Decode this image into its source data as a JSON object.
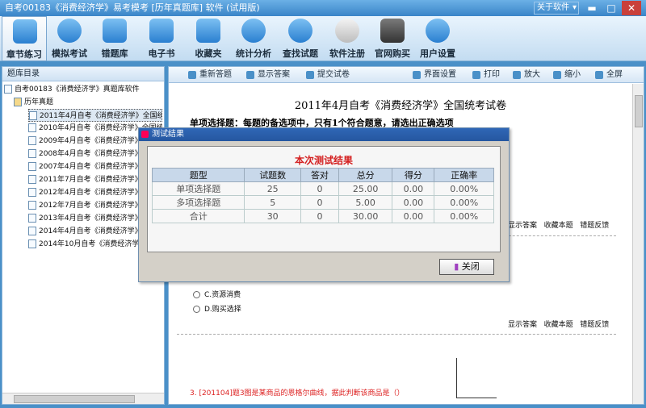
{
  "window": {
    "title": "自考00183《消费经济学》易考模考 [历年真题库] 软件 (试用版)",
    "about_label": "关于软件",
    "minimize": "▬",
    "maximize": "□",
    "close": "✕"
  },
  "toolbar": {
    "items": [
      {
        "label": "章节练习",
        "icon": "chapter-practice-icon"
      },
      {
        "label": "模拟考试",
        "icon": "mock-exam-icon"
      },
      {
        "label": "错题库",
        "icon": "wrong-question-icon"
      },
      {
        "label": "电子书",
        "icon": "ebook-icon"
      },
      {
        "label": "收藏夹",
        "icon": "favorites-icon"
      },
      {
        "label": "统计分析",
        "icon": "statistics-icon"
      },
      {
        "label": "查找试题",
        "icon": "search-icon"
      },
      {
        "label": "软件注册",
        "icon": "register-icon"
      },
      {
        "label": "官网购买",
        "icon": "cart-icon"
      },
      {
        "label": "用户设置",
        "icon": "gear-icon"
      }
    ]
  },
  "left": {
    "header": "题库目录",
    "root": "自考00183《消费经济学》真题库软件",
    "folder": "历年真题",
    "papers": [
      "2011年4月自考《消费经济学》全国统",
      "2010年4月自考《消费经济学》全国统",
      "2009年4月自考《消费经济学》全国统",
      "2008年4月自考《消费经济学》全国统",
      "2007年4月自考《消费经济学》全国统",
      "2011年7月自考《消费经济学》全国统",
      "2012年4月自考《消费经济学》全国统",
      "2012年7月自考《消费经济学》全国统",
      "2013年4月自考《消费经济学》全国统",
      "2014年4月自考《消费经济学》全国统",
      "2014年10月自考《消费经济学》全国"
    ]
  },
  "content_toolbar": {
    "redo": "重新答题",
    "show": "显示答案",
    "submit": "提交试卷",
    "layout": "界面设置",
    "print": "打印",
    "zoomin": "放大",
    "zoomout": "缩小",
    "full": "全屏"
  },
  "document": {
    "title": "2011年4月自考《消费经济学》全国统考试卷",
    "section": "单项选择题：每题的备选项中，只有1个符合题意，请选出正确选项",
    "tools": {
      "show": "显示答案",
      "fav": "收藏本题",
      "report": "错题反馈"
    },
    "optC": "C.资源消费",
    "optD": "D.购买选择",
    "q3": "3. [201104]题3图是某商品的恩格尔曲线，据此判断该商品是（）"
  },
  "dialog": {
    "title": "测试结果",
    "heading": "本次测试结果",
    "columns": [
      "题型",
      "试题数",
      "答对",
      "总分",
      "得分",
      "正确率"
    ],
    "rows": [
      [
        "单项选择题",
        "25",
        "0",
        "25.00",
        "0.00",
        "0.00%"
      ],
      [
        "多项选择题",
        "5",
        "0",
        "5.00",
        "0.00",
        "0.00%"
      ],
      [
        "合计",
        "30",
        "0",
        "30.00",
        "0.00",
        "0.00%"
      ]
    ],
    "close": "关闭"
  }
}
